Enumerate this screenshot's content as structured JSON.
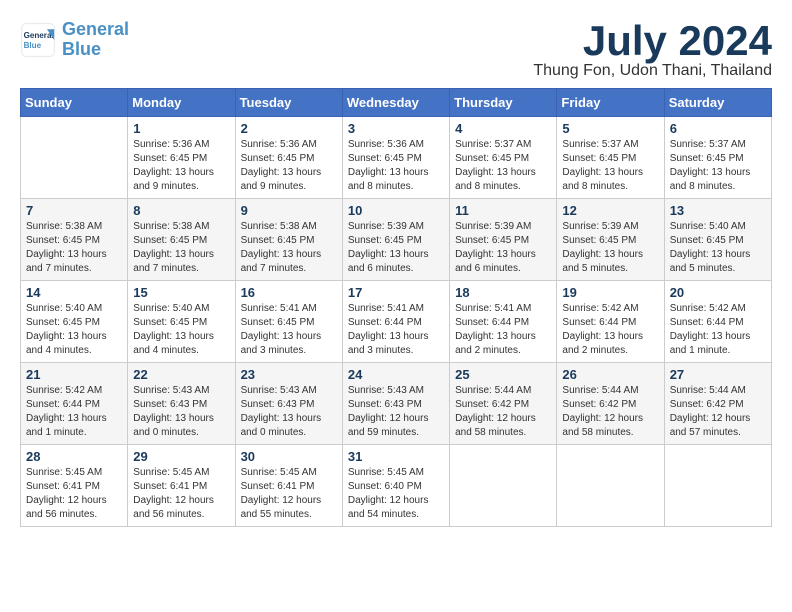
{
  "logo": {
    "text_general": "General",
    "text_blue": "Blue"
  },
  "header": {
    "month": "July 2024",
    "location": "Thung Fon, Udon Thani, Thailand"
  },
  "days_of_week": [
    "Sunday",
    "Monday",
    "Tuesday",
    "Wednesday",
    "Thursday",
    "Friday",
    "Saturday"
  ],
  "weeks": [
    [
      {
        "day": null
      },
      {
        "day": 1,
        "sunrise": "5:36 AM",
        "sunset": "6:45 PM",
        "daylight": "13 hours and 9 minutes."
      },
      {
        "day": 2,
        "sunrise": "5:36 AM",
        "sunset": "6:45 PM",
        "daylight": "13 hours and 9 minutes."
      },
      {
        "day": 3,
        "sunrise": "5:36 AM",
        "sunset": "6:45 PM",
        "daylight": "13 hours and 8 minutes."
      },
      {
        "day": 4,
        "sunrise": "5:37 AM",
        "sunset": "6:45 PM",
        "daylight": "13 hours and 8 minutes."
      },
      {
        "day": 5,
        "sunrise": "5:37 AM",
        "sunset": "6:45 PM",
        "daylight": "13 hours and 8 minutes."
      },
      {
        "day": 6,
        "sunrise": "5:37 AM",
        "sunset": "6:45 PM",
        "daylight": "13 hours and 8 minutes."
      }
    ],
    [
      {
        "day": 7,
        "sunrise": "5:38 AM",
        "sunset": "6:45 PM",
        "daylight": "13 hours and 7 minutes."
      },
      {
        "day": 8,
        "sunrise": "5:38 AM",
        "sunset": "6:45 PM",
        "daylight": "13 hours and 7 minutes."
      },
      {
        "day": 9,
        "sunrise": "5:38 AM",
        "sunset": "6:45 PM",
        "daylight": "13 hours and 7 minutes."
      },
      {
        "day": 10,
        "sunrise": "5:39 AM",
        "sunset": "6:45 PM",
        "daylight": "13 hours and 6 minutes."
      },
      {
        "day": 11,
        "sunrise": "5:39 AM",
        "sunset": "6:45 PM",
        "daylight": "13 hours and 6 minutes."
      },
      {
        "day": 12,
        "sunrise": "5:39 AM",
        "sunset": "6:45 PM",
        "daylight": "13 hours and 5 minutes."
      },
      {
        "day": 13,
        "sunrise": "5:40 AM",
        "sunset": "6:45 PM",
        "daylight": "13 hours and 5 minutes."
      }
    ],
    [
      {
        "day": 14,
        "sunrise": "5:40 AM",
        "sunset": "6:45 PM",
        "daylight": "13 hours and 4 minutes."
      },
      {
        "day": 15,
        "sunrise": "5:40 AM",
        "sunset": "6:45 PM",
        "daylight": "13 hours and 4 minutes."
      },
      {
        "day": 16,
        "sunrise": "5:41 AM",
        "sunset": "6:45 PM",
        "daylight": "13 hours and 3 minutes."
      },
      {
        "day": 17,
        "sunrise": "5:41 AM",
        "sunset": "6:44 PM",
        "daylight": "13 hours and 3 minutes."
      },
      {
        "day": 18,
        "sunrise": "5:41 AM",
        "sunset": "6:44 PM",
        "daylight": "13 hours and 2 minutes."
      },
      {
        "day": 19,
        "sunrise": "5:42 AM",
        "sunset": "6:44 PM",
        "daylight": "13 hours and 2 minutes."
      },
      {
        "day": 20,
        "sunrise": "5:42 AM",
        "sunset": "6:44 PM",
        "daylight": "13 hours and 1 minute."
      }
    ],
    [
      {
        "day": 21,
        "sunrise": "5:42 AM",
        "sunset": "6:44 PM",
        "daylight": "13 hours and 1 minute."
      },
      {
        "day": 22,
        "sunrise": "5:43 AM",
        "sunset": "6:43 PM",
        "daylight": "13 hours and 0 minutes."
      },
      {
        "day": 23,
        "sunrise": "5:43 AM",
        "sunset": "6:43 PM",
        "daylight": "13 hours and 0 minutes."
      },
      {
        "day": 24,
        "sunrise": "5:43 AM",
        "sunset": "6:43 PM",
        "daylight": "12 hours and 59 minutes."
      },
      {
        "day": 25,
        "sunrise": "5:44 AM",
        "sunset": "6:42 PM",
        "daylight": "12 hours and 58 minutes."
      },
      {
        "day": 26,
        "sunrise": "5:44 AM",
        "sunset": "6:42 PM",
        "daylight": "12 hours and 58 minutes."
      },
      {
        "day": 27,
        "sunrise": "5:44 AM",
        "sunset": "6:42 PM",
        "daylight": "12 hours and 57 minutes."
      }
    ],
    [
      {
        "day": 28,
        "sunrise": "5:45 AM",
        "sunset": "6:41 PM",
        "daylight": "12 hours and 56 minutes."
      },
      {
        "day": 29,
        "sunrise": "5:45 AM",
        "sunset": "6:41 PM",
        "daylight": "12 hours and 56 minutes."
      },
      {
        "day": 30,
        "sunrise": "5:45 AM",
        "sunset": "6:41 PM",
        "daylight": "12 hours and 55 minutes."
      },
      {
        "day": 31,
        "sunrise": "5:45 AM",
        "sunset": "6:40 PM",
        "daylight": "12 hours and 54 minutes."
      },
      {
        "day": null
      },
      {
        "day": null
      },
      {
        "day": null
      }
    ]
  ],
  "labels": {
    "sunrise": "Sunrise:",
    "sunset": "Sunset:",
    "daylight": "Daylight:"
  }
}
